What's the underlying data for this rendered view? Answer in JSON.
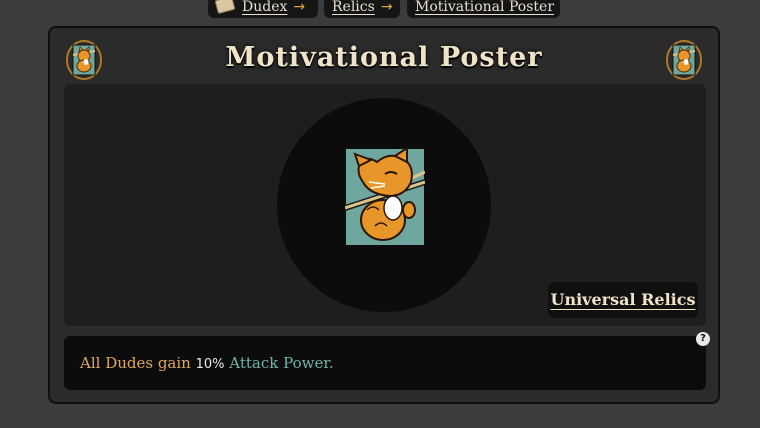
{
  "breadcrumb": {
    "items": [
      {
        "label": "Dudex",
        "icon": "book-icon"
      },
      {
        "label": "Relics"
      },
      {
        "label": "Motivational Poster"
      }
    ],
    "separator": "→",
    "arrow_color": "#e0a43a"
  },
  "relic": {
    "name": "Motivational Poster",
    "image_icon": "hanging-cat-poster-icon",
    "category": "Universal Relics",
    "description": {
      "prefix": "All Dudes gain ",
      "value": "10%",
      "suffix_stat": "Attack Power",
      "end": "."
    },
    "help": "?"
  },
  "colors": {
    "background": "#3b3b3b",
    "panel": "#2b2b2b",
    "title": "#efe3c8",
    "gold_text": "#e0a85a",
    "teal_text": "#6fb5a8"
  }
}
